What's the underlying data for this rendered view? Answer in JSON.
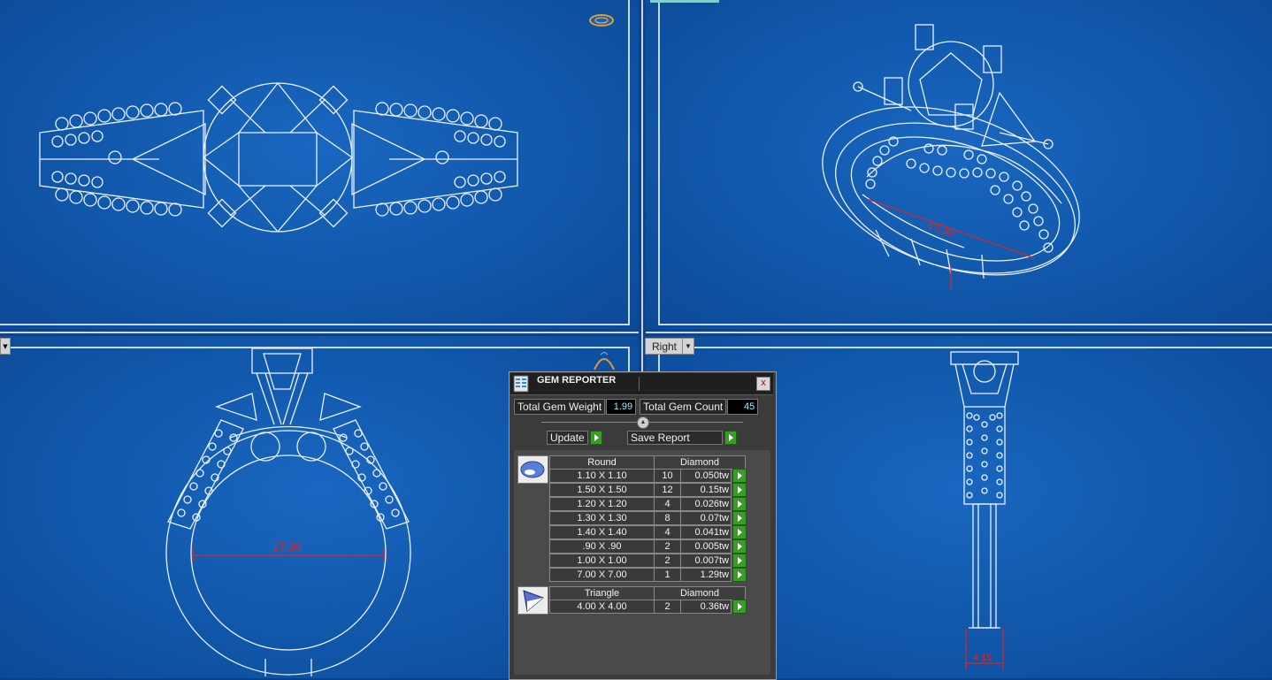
{
  "viewport": {
    "bottom_right_label": "Right",
    "dimensions": {
      "perspective": "17.30",
      "front": "17.30",
      "right": "4.15"
    }
  },
  "gem_reporter": {
    "title": "GEM REPORTER",
    "close_label": "x",
    "total_weight_label": "Total Gem Weight",
    "total_weight_value": "1.99",
    "total_count_label": "Total Gem Count",
    "total_count_value": "45",
    "update_label": "Update",
    "save_label": "Save Report",
    "groups": [
      {
        "shape": "Round",
        "material": "Diamond",
        "icon": "round-gem-icon",
        "rows": [
          {
            "size": "1.10 X 1.10",
            "count": "10",
            "weight": "0.050tw"
          },
          {
            "size": "1.50 X 1.50",
            "count": "12",
            "weight": "0.15tw"
          },
          {
            "size": "1.20 X 1.20",
            "count": "4",
            "weight": "0.026tw"
          },
          {
            "size": "1.30 X 1.30",
            "count": "8",
            "weight": "0.07tw"
          },
          {
            "size": "1.40 X 1.40",
            "count": "4",
            "weight": "0.041tw"
          },
          {
            "size": ".90 X .90",
            "count": "2",
            "weight": "0.005tw"
          },
          {
            "size": "1.00 X 1.00",
            "count": "2",
            "weight": "0.007tw"
          },
          {
            "size": "7.00 X 7.00",
            "count": "1",
            "weight": "1.29tw"
          }
        ]
      },
      {
        "shape": "Triangle",
        "material": "Diamond",
        "icon": "triangle-gem-icon",
        "rows": [
          {
            "size": "4.00 X 4.00",
            "count": "2",
            "weight": "0.36tw"
          }
        ]
      }
    ]
  },
  "colors": {
    "blueprint_bg": "#125aae",
    "line": "#e8f1ff",
    "dimension": "#d42a2a",
    "panel_bg": "#3b3b3b",
    "button_green": "#3a9c28"
  }
}
